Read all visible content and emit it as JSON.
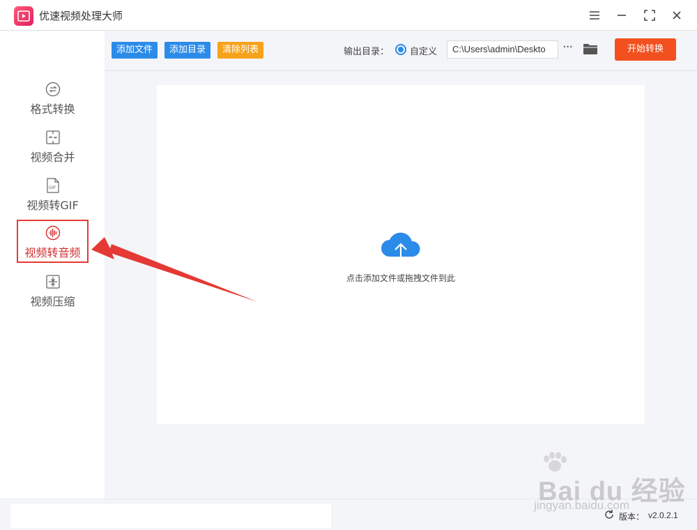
{
  "app": {
    "title": "优速视频处理大师"
  },
  "sidebar": {
    "items": [
      {
        "label": "格式转换",
        "icon": "format-convert-icon"
      },
      {
        "label": "视频合并",
        "icon": "video-merge-icon"
      },
      {
        "label": "视频转GIF",
        "icon": "gif-icon"
      },
      {
        "label": "视频转音频",
        "icon": "audio-wave-icon",
        "active": true
      },
      {
        "label": "视频压缩",
        "icon": "compress-icon"
      }
    ]
  },
  "toolbar": {
    "add_file": "添加文件",
    "add_dir": "添加目录",
    "clear_list": "清除列表",
    "output_label": "输出目录：",
    "radio_label": "自定义",
    "output_path": "C:\\Users\\admin\\Deskto",
    "more": "···",
    "start": "开始转换"
  },
  "dropzone": {
    "hint": "点击添加文件或拖拽文件到此"
  },
  "status": {
    "version_label": "版本：",
    "version": "v2.0.2.1"
  },
  "watermark": {
    "brand": "Bai du 经验",
    "url": "jingyan.baidu.com"
  },
  "colors": {
    "accent": "#2b8be8",
    "start": "#f2501e",
    "clear": "#f7a21b",
    "highlight": "#e53935"
  }
}
